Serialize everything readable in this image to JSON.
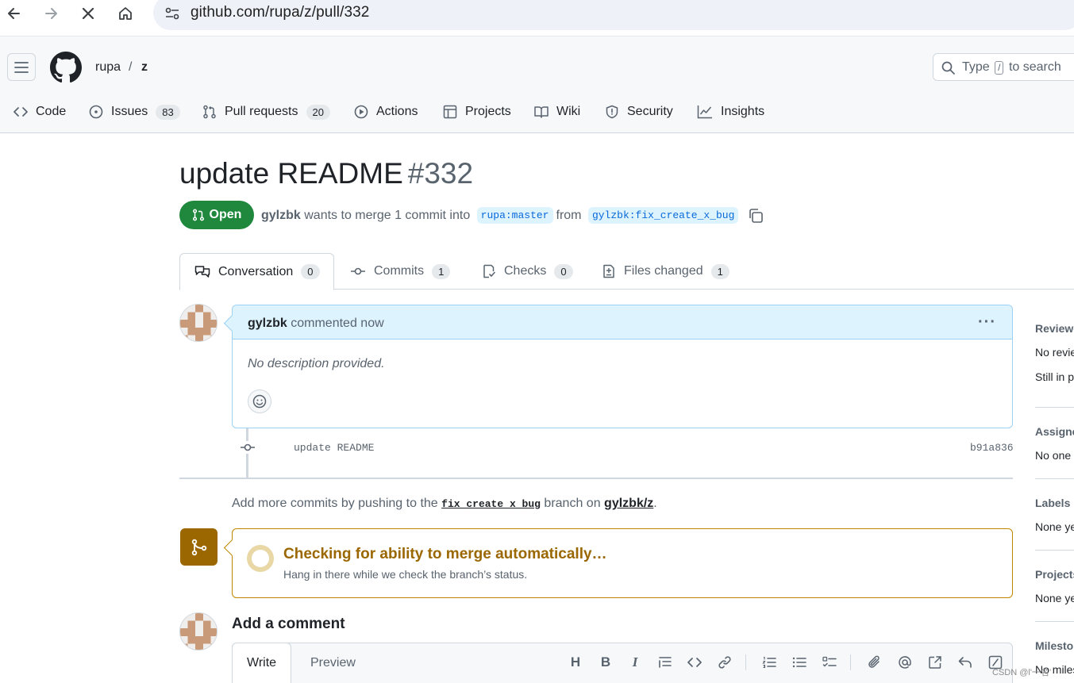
{
  "browser": {
    "url": "github.com/rupa/z/pull/332"
  },
  "header": {
    "owner": "rupa",
    "separator": "/",
    "repo": "z",
    "search_prefix": "Type",
    "search_key": "/",
    "search_suffix": "to search"
  },
  "repo_tabs": [
    {
      "label": "Code",
      "icon": "code-icon"
    },
    {
      "label": "Issues",
      "count": "83",
      "icon": "issue-icon"
    },
    {
      "label": "Pull requests",
      "count": "20",
      "icon": "pull-request-icon"
    },
    {
      "label": "Actions",
      "icon": "play-icon"
    },
    {
      "label": "Projects",
      "icon": "table-icon"
    },
    {
      "label": "Wiki",
      "icon": "book-icon"
    },
    {
      "label": "Security",
      "icon": "shield-icon"
    },
    {
      "label": "Insights",
      "icon": "graph-icon"
    }
  ],
  "pr": {
    "title": "update README",
    "number": "#332",
    "state": "Open",
    "author": "gylzbk",
    "meta_text": "wants to merge 1 commit into",
    "base_branch": "rupa:master",
    "from_text": "from",
    "head_branch": "gylzbk:fix_create_x_bug"
  },
  "pr_tabs": [
    {
      "label": "Conversation",
      "count": "0",
      "icon": "comment-discussion-icon"
    },
    {
      "label": "Commits",
      "count": "1",
      "icon": "git-commit-icon"
    },
    {
      "label": "Checks",
      "count": "0",
      "icon": "checklist-icon"
    },
    {
      "label": "Files changed",
      "count": "1",
      "icon": "file-diff-icon"
    }
  ],
  "comment": {
    "author": "gylzbk",
    "action": "commented now",
    "more": "···",
    "body": "No description provided."
  },
  "commit": {
    "message": "update README",
    "sha": "b91a836"
  },
  "push_hint": {
    "prefix": "Add more commits by pushing to the",
    "branch": "fix_create_x_bug",
    "middle": "branch on",
    "repo": "gylzbk/z",
    "suffix": "."
  },
  "merge": {
    "title": "Checking for ability to merge automatically…",
    "subtitle": "Hang in there while we check the branch’s status."
  },
  "new_comment": {
    "title": "Add a comment",
    "write_tab": "Write",
    "preview_tab": "Preview",
    "tools": {
      "heading": "H",
      "bold": "B",
      "italic": "I"
    }
  },
  "sidebar": {
    "reviewers_label": "Reviewers",
    "reviewers_value": "No reviews",
    "reviewers_value2": "Still in progress?",
    "assignees_label": "Assignees",
    "assignees_value": "No one",
    "labels_label": "Labels",
    "labels_value": "None yet",
    "projects_label": "Projects",
    "projects_value": "None yet",
    "milestone_label": "Milestone",
    "milestone_value": "No milestone"
  },
  "watermark": "CSDN @l'一名’",
  "colors": {
    "open_green": "#1f883d",
    "merge_amber": "#9a6700",
    "comment_blue": "#ddf4ff",
    "link_blue": "#0969da"
  }
}
